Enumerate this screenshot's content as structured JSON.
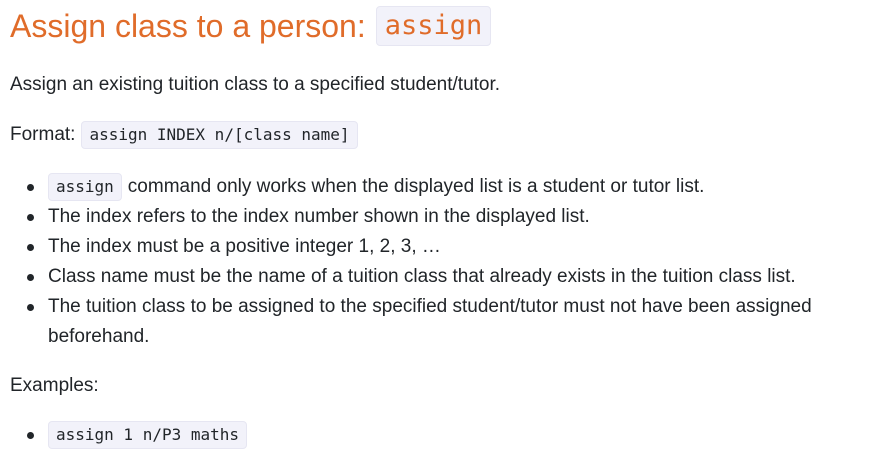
{
  "heading": {
    "text": "Assign class to a person:",
    "command": "assign"
  },
  "description": "Assign an existing tuition class to a specified student/tutor.",
  "format": {
    "label": "Format:",
    "syntax": "assign INDEX n/[class name]"
  },
  "rules": [
    {
      "code": "assign",
      "text": "command only works when the displayed list is a student or tutor list."
    },
    {
      "text": "The index refers to the index number shown in the displayed list."
    },
    {
      "text": "The index must be a positive integer 1, 2, 3, …"
    },
    {
      "text": "Class name must be the name of a tuition class that already exists in the tuition class list."
    },
    {
      "text": "The tuition class to be assigned to the specified student/tutor must not have been assigned beforehand."
    }
  ],
  "examples": {
    "label": "Examples:",
    "items": [
      "assign 1 n/P3 maths"
    ]
  },
  "colors": {
    "heading": "#e06c2a",
    "code_background": "#f2f2fa",
    "text": "#212529"
  }
}
